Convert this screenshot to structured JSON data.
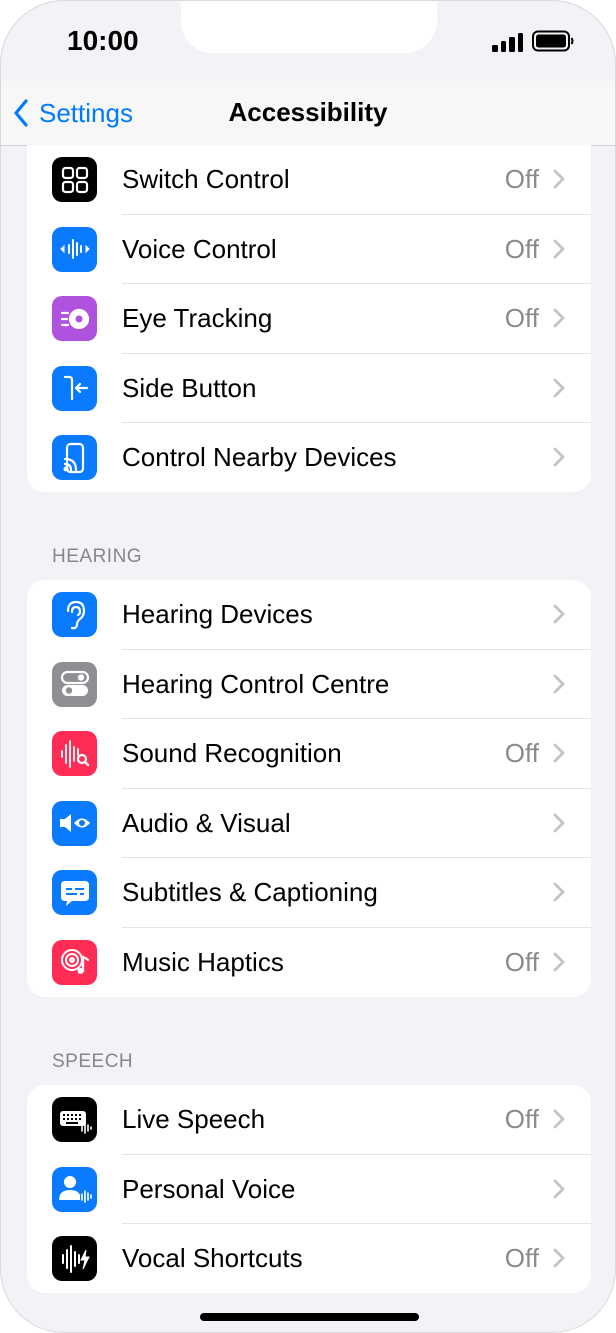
{
  "status_bar": {
    "time": "10:00"
  },
  "nav": {
    "back_label": "Settings",
    "title": "Accessibility"
  },
  "groups": [
    {
      "header": "",
      "rows": [
        {
          "label": "Switch Control",
          "value": "Off",
          "icon": "switch-control-icon",
          "icon_color": "#000000"
        },
        {
          "label": "Voice Control",
          "value": "Off",
          "icon": "voice-control-icon",
          "icon_color": "#0a7aff"
        },
        {
          "label": "Eye Tracking",
          "value": "Off",
          "icon": "eye-tracking-icon",
          "icon_color": "#af52de"
        },
        {
          "label": "Side Button",
          "value": "",
          "icon": "side-button-icon",
          "icon_color": "#0a7aff"
        },
        {
          "label": "Control Nearby Devices",
          "value": "",
          "icon": "control-nearby-devices-icon",
          "icon_color": "#0a7aff"
        }
      ]
    },
    {
      "header": "HEARING",
      "rows": [
        {
          "label": "Hearing Devices",
          "value": "",
          "icon": "ear-icon",
          "icon_color": "#0a7aff"
        },
        {
          "label": "Hearing Control Centre",
          "value": "",
          "icon": "toggles-icon",
          "icon_color": "#8e8e93"
        },
        {
          "label": "Sound Recognition",
          "value": "Off",
          "icon": "sound-recognition-icon",
          "icon_color": "#ff2d55"
        },
        {
          "label": "Audio & Visual",
          "value": "",
          "icon": "speaker-eye-icon",
          "icon_color": "#0a7aff"
        },
        {
          "label": "Subtitles & Captioning",
          "value": "",
          "icon": "captions-bubble-icon",
          "icon_color": "#0a7aff"
        },
        {
          "label": "Music Haptics",
          "value": "Off",
          "icon": "music-haptics-icon",
          "icon_color": "#ff2d55"
        }
      ]
    },
    {
      "header": "SPEECH",
      "rows": [
        {
          "label": "Live Speech",
          "value": "Off",
          "icon": "keyboard-waveform-icon",
          "icon_color": "#000000"
        },
        {
          "label": "Personal Voice",
          "value": "",
          "icon": "personal-voice-icon",
          "icon_color": "#0a7aff"
        },
        {
          "label": "Vocal Shortcuts",
          "value": "Off",
          "icon": "vocal-shortcuts-icon",
          "icon_color": "#000000"
        }
      ]
    }
  ]
}
